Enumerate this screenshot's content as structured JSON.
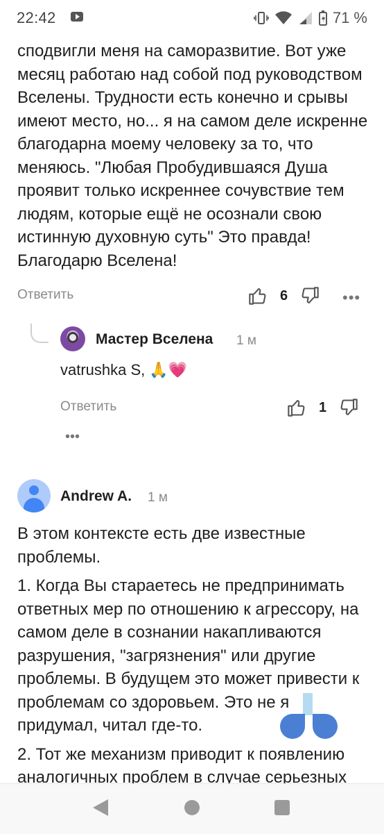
{
  "status_bar": {
    "time": "22:42",
    "battery_percent": "71 %",
    "icons": [
      "youtube-icon",
      "vibrate-icon",
      "wifi-icon",
      "signal-icon",
      "battery-icon"
    ]
  },
  "comment": {
    "text": "сподвигли меня на саморазвитие. Вот уже месяц работаю над собой под руководством Вселены. Трудности есть конечно и срывы имеют место, но... я на самом деле искренне благодарна моему человеку за то, что меняюсь. \"Любая Пробудившаяся Душа проявит только искреннее сочувствие тем людям, которые ещё не осознали свою истинную духовную суть\" Это правда! Благодарю Вселена!",
    "reply_label": "Ответить",
    "likes": "6",
    "more": "•••"
  },
  "reply": {
    "author": "Мастер Вселена",
    "time": "1 м",
    "text": "vatrushka S, 🙏💗",
    "reply_label": "Ответить",
    "likes": "1",
    "more": "•••"
  },
  "andrew_comment": {
    "author": "Andrew A.",
    "time": "1 м",
    "paragraphs": [
      "В этом контексте есть две известные проблемы.",
      "1. Когда Вы стараетесь не предпринимать ответных мер по отношению к агрессору, на самом деле в сознании накапливаются разрушения, \"загрязнения\" или другие проблемы. В будущем это может привести к проблемам со здоровьем. Это не я придумал, читал где-то.",
      "2. Тот же механизм приводит к появлению аналогичных проблем в случае серьезных"
    ]
  },
  "colors": {
    "text": "#1f1f1f",
    "muted": "#8a8a8a",
    "selection_handle": "#4a7fd3",
    "avatar_bg": "#aecbfa"
  }
}
